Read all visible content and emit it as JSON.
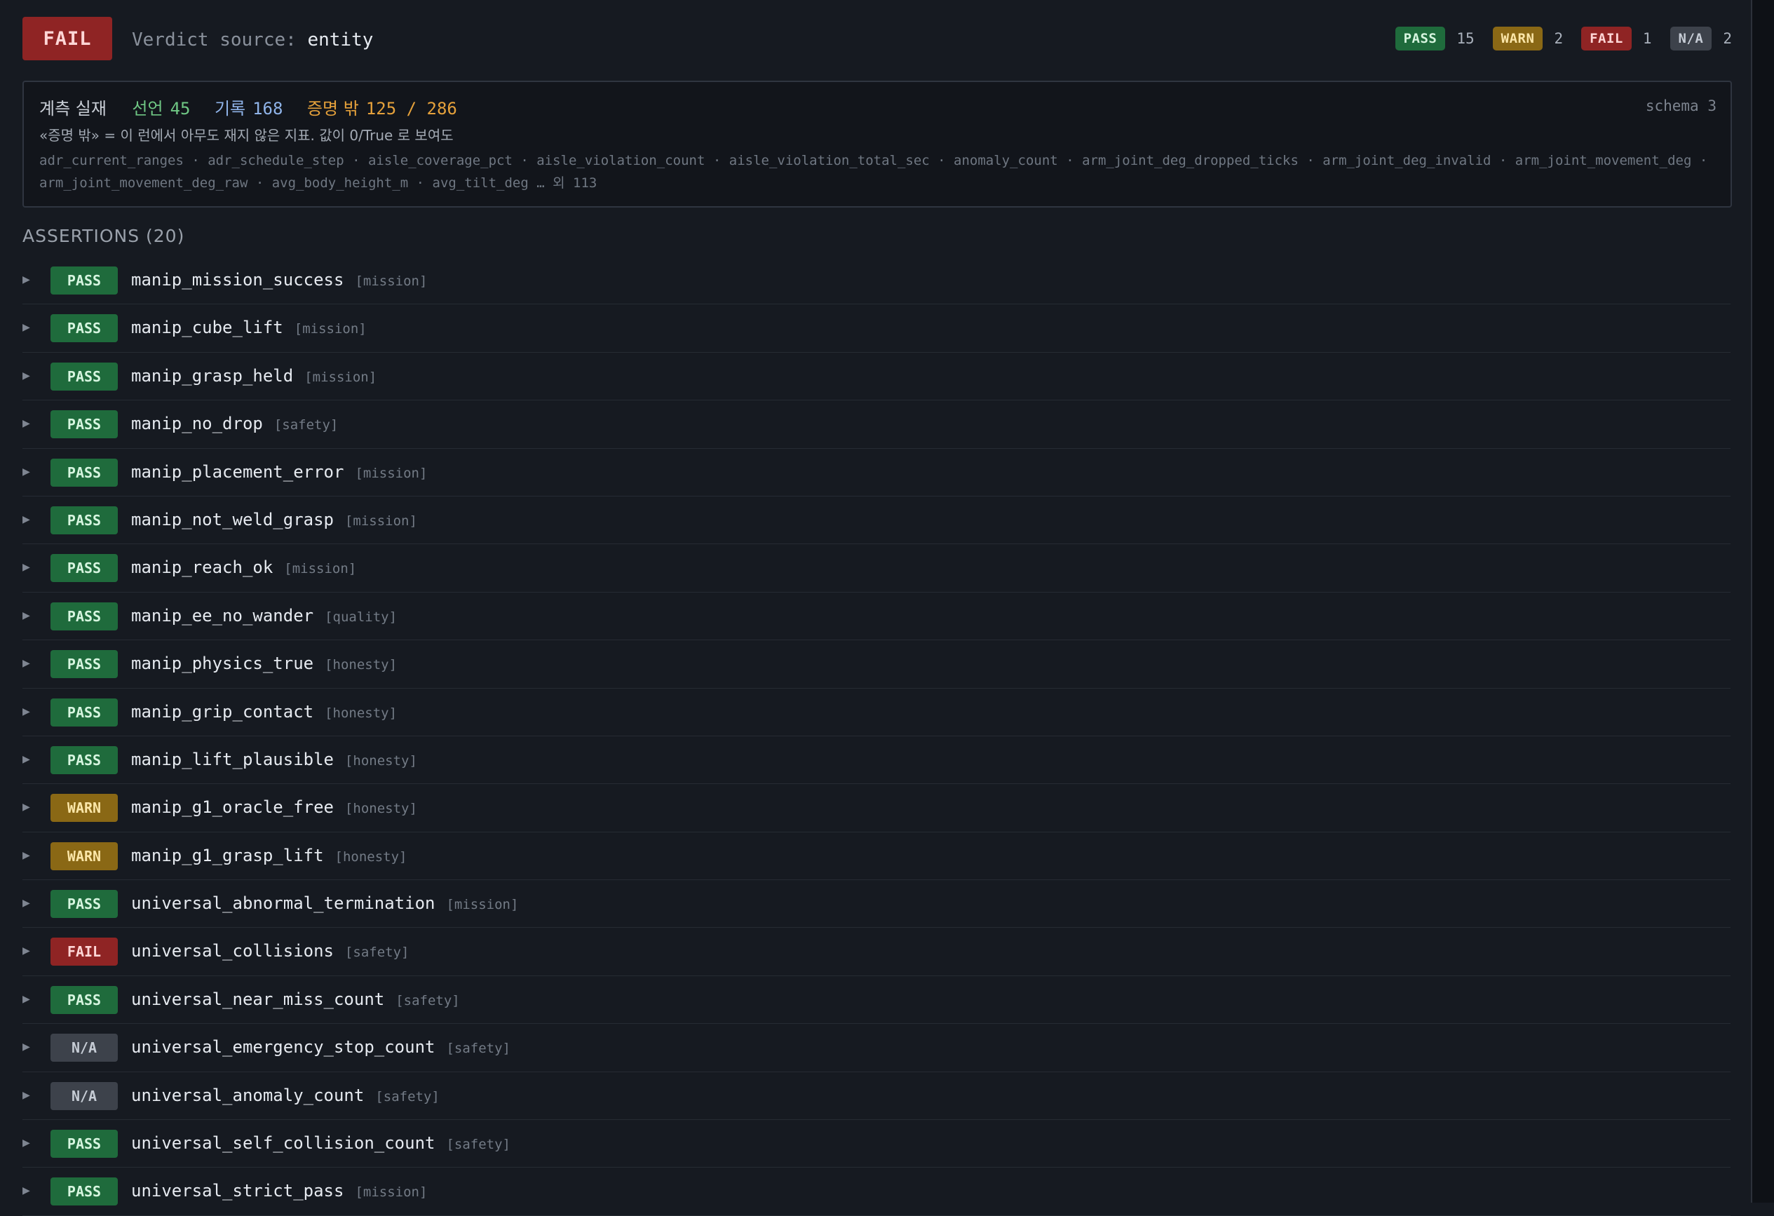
{
  "header": {
    "verdict": "FAIL",
    "verdict_source_label": "Verdict source:",
    "verdict_source_value": "entity",
    "counts": [
      {
        "label": "PASS",
        "count": "15",
        "status": "pass"
      },
      {
        "label": "WARN",
        "count": "2",
        "status": "warn"
      },
      {
        "label": "FAIL",
        "count": "1",
        "status": "fail"
      },
      {
        "label": "N/A",
        "count": "2",
        "status": "na"
      }
    ]
  },
  "observed": {
    "title": "계측 실재",
    "declared_label": "선언",
    "declared_count": "45",
    "recorded_label": "기록",
    "recorded_count": "168",
    "unproven_label": "증명 밖",
    "unproven_count": "125 / 286",
    "schema": "schema 3",
    "note": "«증명 밖» = 이 런에서 아무도 재지 않은 지표. 값이 0/True 로 보여도",
    "keys": "adr_current_ranges · adr_schedule_step · aisle_coverage_pct · aisle_violation_count · aisle_violation_total_sec · anomaly_count · arm_joint_deg_dropped_ticks · arm_joint_deg_invalid · arm_joint_movement_deg · arm_joint_movement_deg_raw · avg_body_height_m · avg_tilt_deg … 외 113"
  },
  "assertions": {
    "title": "ASSERTIONS (20)",
    "expand_glyph": "▶",
    "items": [
      {
        "status": "PASS",
        "name": "manip_mission_success",
        "category": "[mission]"
      },
      {
        "status": "PASS",
        "name": "manip_cube_lift",
        "category": "[mission]"
      },
      {
        "status": "PASS",
        "name": "manip_grasp_held",
        "category": "[mission]"
      },
      {
        "status": "PASS",
        "name": "manip_no_drop",
        "category": "[safety]"
      },
      {
        "status": "PASS",
        "name": "manip_placement_error",
        "category": "[mission]"
      },
      {
        "status": "PASS",
        "name": "manip_not_weld_grasp",
        "category": "[mission]"
      },
      {
        "status": "PASS",
        "name": "manip_reach_ok",
        "category": "[mission]"
      },
      {
        "status": "PASS",
        "name": "manip_ee_no_wander",
        "category": "[quality]"
      },
      {
        "status": "PASS",
        "name": "manip_physics_true",
        "category": "[honesty]"
      },
      {
        "status": "PASS",
        "name": "manip_grip_contact",
        "category": "[honesty]"
      },
      {
        "status": "PASS",
        "name": "manip_lift_plausible",
        "category": "[honesty]"
      },
      {
        "status": "WARN",
        "name": "manip_g1_oracle_free",
        "category": "[honesty]"
      },
      {
        "status": "WARN",
        "name": "manip_g1_grasp_lift",
        "category": "[honesty]"
      },
      {
        "status": "PASS",
        "name": "universal_abnormal_termination",
        "category": "[mission]"
      },
      {
        "status": "FAIL",
        "name": "universal_collisions",
        "category": "[safety]"
      },
      {
        "status": "PASS",
        "name": "universal_near_miss_count",
        "category": "[safety]"
      },
      {
        "status": "N/A",
        "name": "universal_emergency_stop_count",
        "category": "[safety]"
      },
      {
        "status": "N/A",
        "name": "universal_anomaly_count",
        "category": "[safety]"
      },
      {
        "status": "PASS",
        "name": "universal_self_collision_count",
        "category": "[safety]"
      },
      {
        "status": "PASS",
        "name": "universal_strict_pass",
        "category": "[mission]"
      }
    ]
  }
}
